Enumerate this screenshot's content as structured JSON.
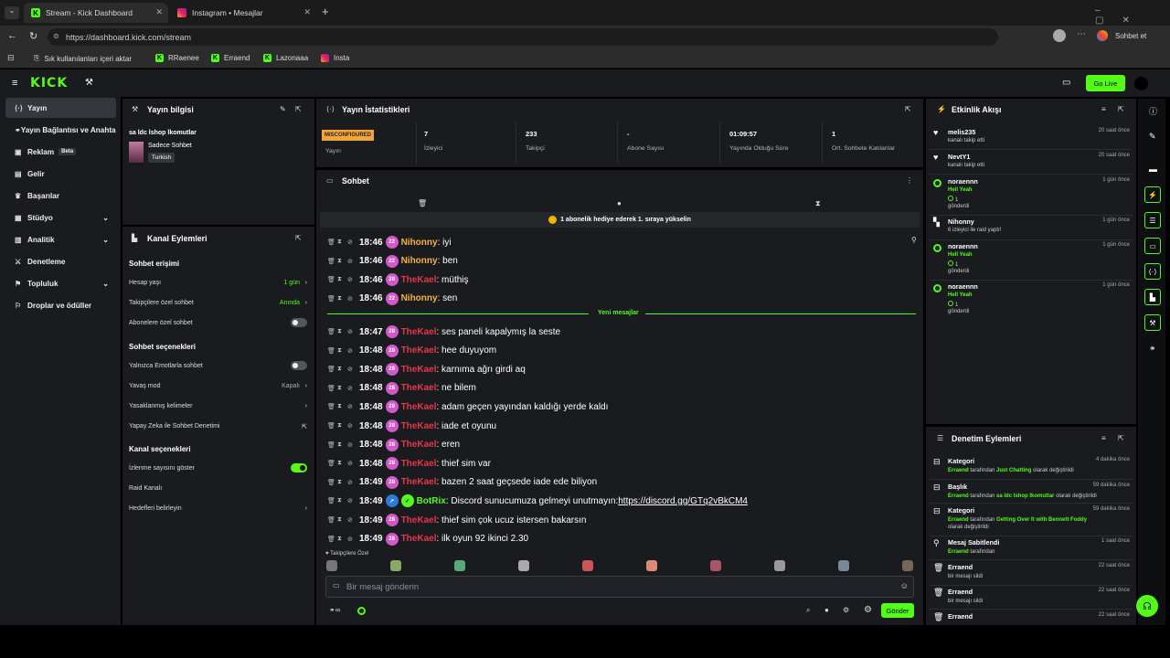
{
  "browser": {
    "tabs": [
      {
        "title": "Stream - Kick Dashboard",
        "icon": "kick-icon"
      },
      {
        "title": "Instagram • Mesajlar",
        "icon": "instagram-icon"
      }
    ],
    "url": "https://dashboard.kick.com/stream",
    "chat_label": "Sohbet et",
    "bookmarks": [
      {
        "label": "Sık kullanılanları içeri aktar",
        "icon": "import-icon"
      },
      {
        "label": "RRaenee",
        "icon": "kick-icon"
      },
      {
        "label": "Erraend",
        "icon": "kick-icon"
      },
      {
        "label": "Lazonaaa",
        "icon": "kick-icon"
      },
      {
        "label": "Insta",
        "icon": "instagram-icon"
      }
    ]
  },
  "header": {
    "logo": "KICK",
    "go_live": "Go Live"
  },
  "sidebar": {
    "items": [
      {
        "label": "Yayın",
        "icon": "broadcast-icon",
        "active": true
      },
      {
        "label": "Yayın Bağlantısı ve Anahtarı",
        "icon": "link-icon"
      },
      {
        "label": "Reklam",
        "icon": "ad-icon",
        "badge": "Beta"
      },
      {
        "label": "Gelir",
        "icon": "revenue-icon"
      },
      {
        "label": "Başarılar",
        "icon": "trophy-icon"
      },
      {
        "label": "Stüdyo",
        "icon": "studio-icon",
        "expandable": true
      },
      {
        "label": "Analitik",
        "icon": "analytics-icon",
        "expandable": true
      },
      {
        "label": "Denetleme",
        "icon": "moderation-icon"
      },
      {
        "label": "Topluluk",
        "icon": "community-icon",
        "expandable": true
      },
      {
        "label": "Droplar ve ödüller",
        "icon": "drops-icon"
      }
    ]
  },
  "stream_info": {
    "title": "Yayın bilgisi",
    "stream_title": "sa ldc lshop lkomutlar",
    "category": "Sadece Sohbet",
    "language": "Turkish"
  },
  "channel_actions": {
    "title": "Kanal Eylemleri",
    "chat_access": {
      "heading": "Sohbet erişimi",
      "rows": [
        {
          "label": "Hesap yaşı",
          "value": "1 gün"
        },
        {
          "label": "Takipçilere özel sohbet",
          "value": "Anında"
        },
        {
          "label": "Abonelere özel sohbet",
          "toggle": false
        }
      ]
    },
    "chat_options": {
      "heading": "Sohbet seçenekleri",
      "rows": [
        {
          "label": "Yalnızca Emotlarla sohbet",
          "toggle": false
        },
        {
          "label": "Yavaş mod",
          "value": "Kapalı"
        },
        {
          "label": "Yasaklanmış kelimeler"
        },
        {
          "label": "Yapay Zeka ile Sohbet Denetimi"
        }
      ]
    },
    "channel_options": {
      "heading": "Kanal seçenekleri",
      "rows": [
        {
          "label": "İzlenme sayısını göster",
          "toggle": true
        },
        {
          "label": "Raid Kanalı"
        },
        {
          "label": "Hedefleri belirleyin"
        }
      ]
    }
  },
  "stats": {
    "title": "Yayın İstatistikleri",
    "items": [
      {
        "value": "MISCONFIGURED",
        "label": "Yayın"
      },
      {
        "value": "7",
        "label": "İzleyici"
      },
      {
        "value": "233",
        "label": "Takipçi"
      },
      {
        "value": "-",
        "label": "Abone Sayısı"
      },
      {
        "value": "01:09:57",
        "label": "Yayında Olduğu Süre"
      },
      {
        "value": "1",
        "label": "Ort. Sohbete Katılanlar"
      }
    ]
  },
  "chat": {
    "title": "Sohbet",
    "banner": "1 abonelik hediye ederek 1. sıraya yükselin",
    "new_messages": "Yeni mesajlar",
    "messages_before": [
      {
        "time": "18:46",
        "level": "22",
        "user": "Nihonny",
        "type": "nih",
        "text": "iyi"
      },
      {
        "time": "18:46",
        "level": "22",
        "user": "Nihonny",
        "type": "nih",
        "text": "ben"
      },
      {
        "time": "18:46",
        "level": "28",
        "user": "TheKael",
        "type": "the",
        "text": "müthiş"
      },
      {
        "time": "18:46",
        "level": "22",
        "user": "Nihonny",
        "type": "nih",
        "text": "sen"
      }
    ],
    "messages_after": [
      {
        "time": "18:47",
        "level": "28",
        "user": "TheKael",
        "type": "the",
        "text": "ses paneli kapalymış la seste"
      },
      {
        "time": "18:48",
        "level": "28",
        "user": "TheKael",
        "type": "the",
        "text": "hee duyuyom"
      },
      {
        "time": "18:48",
        "level": "28",
        "user": "TheKael",
        "type": "the",
        "text": "karnıma ağrı girdi aq"
      },
      {
        "time": "18:48",
        "level": "28",
        "user": "TheKael",
        "type": "the",
        "text": "ne bilem"
      },
      {
        "time": "18:48",
        "level": "28",
        "user": "TheKael",
        "type": "the",
        "text": "adam geçen yayından kaldığı yerde kaldı"
      },
      {
        "time": "18:48",
        "level": "28",
        "user": "TheKael",
        "type": "the",
        "text": "iade et oyunu"
      },
      {
        "time": "18:48",
        "level": "28",
        "user": "TheKael",
        "type": "the",
        "text": "eren"
      },
      {
        "time": "18:48",
        "level": "28",
        "user": "TheKael",
        "type": "the",
        "text": "thief sim var"
      },
      {
        "time": "18:49",
        "level": "28",
        "user": "TheKael",
        "type": "the",
        "text": "bazen 2 saat geçsede iade ede biliyon"
      },
      {
        "time": "18:49",
        "level": "",
        "user": "BotRix",
        "type": "bot",
        "text": "Discord sunucumuza gelmeyi unutmayın: ",
        "link": "https://discord.gg/GTq2vBkCM4"
      },
      {
        "time": "18:49",
        "level": "28",
        "user": "TheKael",
        "type": "the",
        "text": "thief sim çok ucuz istersen bakarsın"
      },
      {
        "time": "18:49",
        "level": "28",
        "user": "TheKael",
        "type": "the",
        "text": "ilk oyun 92 ikinci 2.30"
      }
    ],
    "followers_only": "Takipçilere Özel",
    "input_placeholder": "Bir mesaj gönderin",
    "send": "Gönder"
  },
  "activity": {
    "title": "Etkinlik Akışı",
    "events": [
      {
        "name": "melis235",
        "desc": "kanalı takip etti",
        "time": "20 saat önce",
        "icon": "heart-icon"
      },
      {
        "name": "NevtY1",
        "desc": "kanalı takip etti",
        "time": "20 saat önce",
        "icon": "heart-icon"
      },
      {
        "name": "noraennn",
        "line1": "Hell Yeah",
        "line2": "1",
        "line3": "gönderdi",
        "time": "1 gün önce",
        "icon": "kick-coin-icon"
      },
      {
        "name": "Nihonny",
        "desc": "6 izleyici ile raid yaptı!",
        "time": "1 gün önce",
        "icon": "raid-icon"
      },
      {
        "name": "noraennn",
        "line1": "Hell Yeah",
        "line2": "1",
        "line3": "gönderdi",
        "time": "1 gün önce",
        "icon": "kick-coin-icon"
      },
      {
        "name": "noraennn",
        "line1": "Hell Yeah",
        "line2": "1",
        "line3": "gönderdi",
        "time": "1 gün önce",
        "icon": "kick-coin-icon"
      }
    ]
  },
  "moderation": {
    "title": "Denetim Eylemleri",
    "items": [
      {
        "name": "Kategori",
        "by": "Erraend",
        "mid": " tarafından ",
        "target": "Just Chatting",
        "end": " olarak değiştirildi",
        "time": "4 dakika önce",
        "icon": "category-icon"
      },
      {
        "name": "Başlık",
        "by": "Erraend",
        "mid": " tarafından ",
        "target": "sa ldc lshop lkomutlar",
        "end": " olarak değiştirildi",
        "time": "59 dakika önce",
        "icon": "category-icon"
      },
      {
        "name": "Kategori",
        "by": "Erraend",
        "mid": " tarafından ",
        "target": "Getting Over It with Bennett Foddy",
        "end": " olarak değiştirildi",
        "time": "59 dakika önce",
        "icon": "category-icon"
      },
      {
        "name": "Mesaj Sabitlendi",
        "by": "Erraend",
        "mid": " tarafından",
        "target": "",
        "end": "",
        "time": "1 saat önce",
        "icon": "pin-icon"
      },
      {
        "name": "Erraend",
        "by": "",
        "mid": "bir mesajı sildi",
        "target": "",
        "end": "",
        "time": "22 saat önce",
        "icon": "trash-icon"
      },
      {
        "name": "Erraend",
        "by": "",
        "mid": "bir mesajı sildi",
        "target": "",
        "end": "",
        "time": "22 saat önce",
        "icon": "trash-icon"
      },
      {
        "name": "Erraend",
        "by": "",
        "mid": "",
        "target": "",
        "end": "",
        "time": "22 saat önce",
        "icon": "trash-icon"
      }
    ]
  }
}
